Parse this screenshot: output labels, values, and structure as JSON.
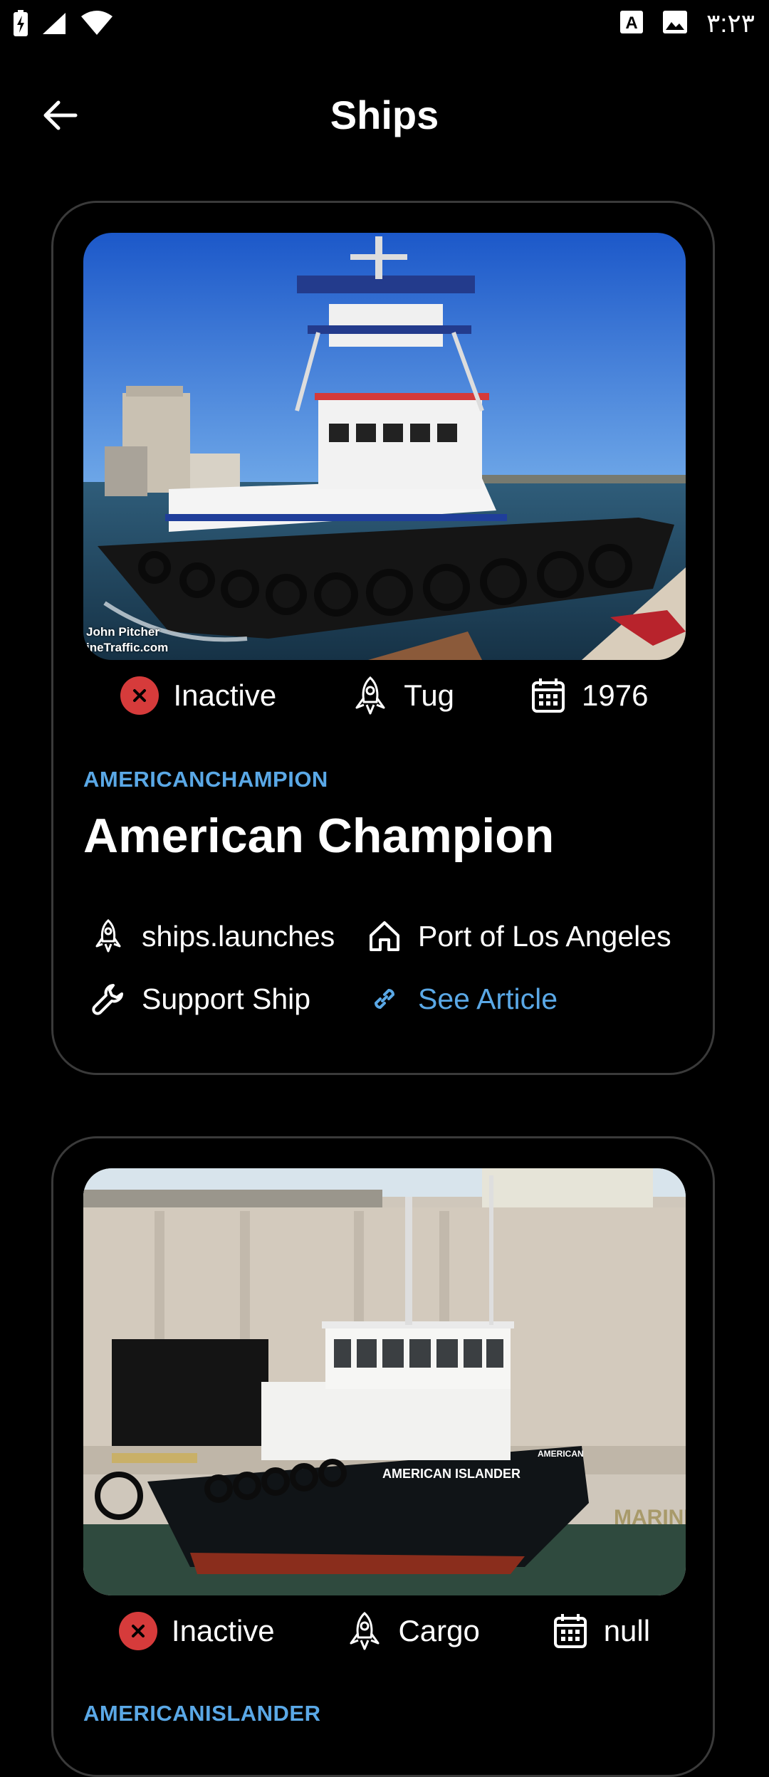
{
  "status_bar": {
    "time": "٣:٢٣",
    "icons": [
      "battery-charging-icon",
      "cellular-signal-icon",
      "wifi-icon",
      "keyboard-a-icon",
      "image-icon"
    ]
  },
  "header": {
    "title": "Ships",
    "back_icon": "arrow-left-icon"
  },
  "ships": [
    {
      "status": "Inactive",
      "type": "Tug",
      "year": "1976",
      "id": "AMERICANCHAMPION",
      "name": "American Champion",
      "launches": "ships.launches",
      "home_port": "Port of Los Angeles",
      "role": "Support Ship",
      "link": "See Article",
      "image_caption_line1": "John Pitcher",
      "image_caption_line2": "ineTraffic.com"
    },
    {
      "status": "Inactive",
      "type": "Cargo",
      "year": "null",
      "id": "AMERICANISLANDER",
      "hull_name": "AMERICAN ISLANDER",
      "hull_name_stern": "AMERICAN",
      "dock_sign": "MARINE"
    }
  ],
  "colors": {
    "background": "#000000",
    "accent_blue": "#5aa8e6",
    "inactive_red": "#d63b3b",
    "card_border": "#3a3a3a"
  }
}
